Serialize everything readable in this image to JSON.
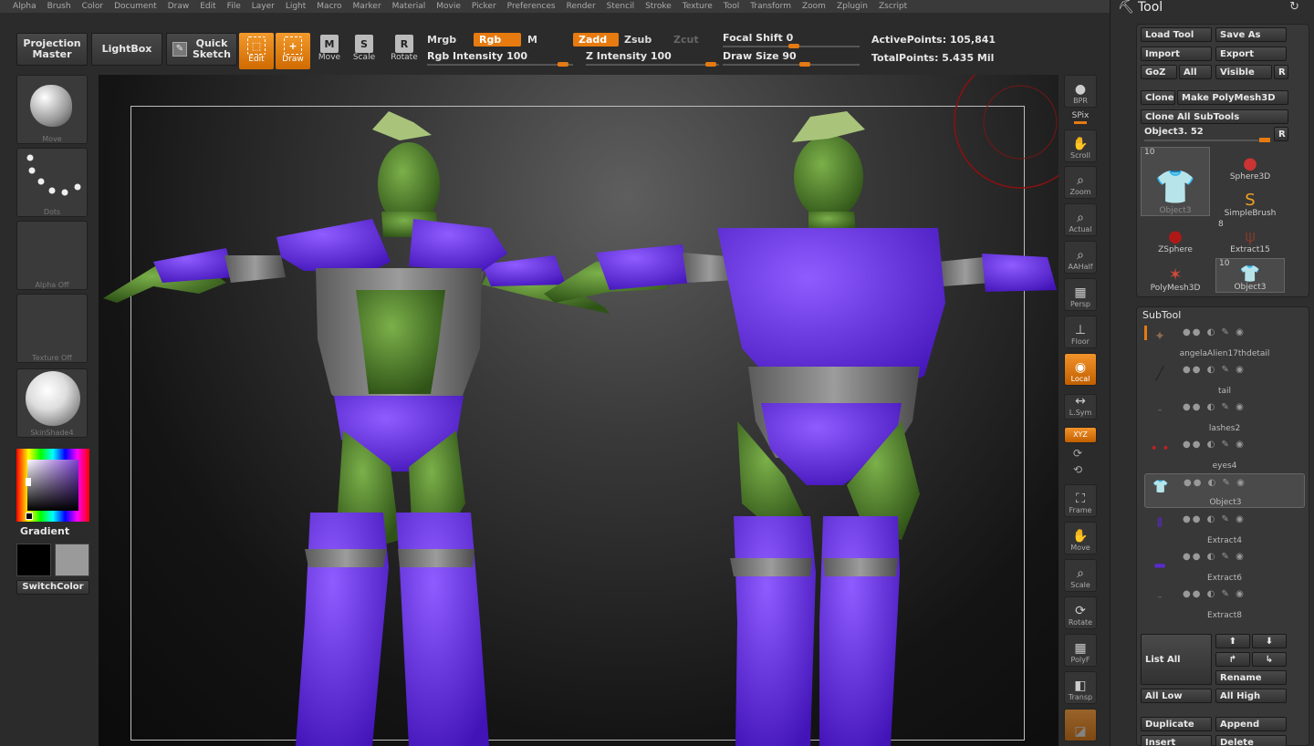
{
  "menu": [
    "Alpha",
    "Brush",
    "Color",
    "Document",
    "Draw",
    "Edit",
    "File",
    "Layer",
    "Light",
    "Macro",
    "Marker",
    "Material",
    "Movie",
    "Picker",
    "Preferences",
    "Render",
    "Stencil",
    "Stroke",
    "Texture",
    "Tool",
    "Transform",
    "Zoom",
    "Zplugin",
    "Zscript"
  ],
  "toolbar": {
    "projection_master": "Projection Master",
    "lightbox": "LightBox",
    "quick_sketch": "Quick Sketch",
    "edit": "Edit",
    "draw": "Draw",
    "move": "Move",
    "scale": "Scale",
    "rotate": "Rotate",
    "mrgb": "Mrgb",
    "rgb": "Rgb",
    "m": "M",
    "zadd": "Zadd",
    "zsub": "Zsub",
    "zcut": "Zcut",
    "rgb_intensity": "Rgb Intensity 100",
    "z_intensity": "Z Intensity 100",
    "focal_shift": "Focal Shift 0",
    "draw_size": "Draw Size 90",
    "active_points": "ActivePoints: 105,841",
    "total_points": "TotalPoints: 5.435 Mil",
    "sliders": {
      "rgb_intensity": 100,
      "z_intensity": 100,
      "focal_shift": 0,
      "draw_size": 90
    }
  },
  "left": {
    "brush": "Move",
    "stroke": "Dots",
    "alpha": "Alpha  Off",
    "texture": "Texture  Off",
    "material": "SkinShade4",
    "gradient": "Gradient",
    "switch_color": "SwitchColor"
  },
  "right_strip": [
    "BPR",
    "SPix",
    "Scroll",
    "Zoom",
    "Actual",
    "AAHalf",
    "Persp",
    "Floor",
    "Local",
    "L.Sym",
    "XYZ",
    "Frame",
    "Move",
    "Scale",
    "Rotate",
    "PolyF",
    "Transp"
  ],
  "tool_panel": {
    "title": "Tool",
    "load_tool": "Load Tool",
    "save_as": "Save As",
    "import": "Import",
    "export": "Export",
    "goz": "GoZ",
    "all": "All",
    "visible": "Visible",
    "r": "R",
    "clone": "Clone",
    "make_polymesh": "Make PolyMesh3D",
    "clone_all": "Clone  All  SubTools",
    "object_slider": "Object3. 52",
    "tools": [
      {
        "name": "Object3",
        "count": "10"
      },
      {
        "name": "Sphere3D",
        "count": ""
      },
      {
        "name": "SimpleBrush",
        "count": ""
      },
      {
        "name": "ZSphere",
        "count": ""
      },
      {
        "name": "Extract15",
        "count": "8"
      },
      {
        "name": "PolyMesh3D",
        "count": ""
      },
      {
        "name": "Object3",
        "count": "10"
      }
    ],
    "subtool_title": "SubTool",
    "subtools": [
      "angelaAlien17thdetail",
      "tail",
      "lashes2",
      "eyes4",
      "Object3",
      "Extract4",
      "Extract6",
      "Extract8"
    ],
    "list_all": "List  All",
    "rename": "Rename",
    "all_low": "All Low",
    "all_high": "All High",
    "duplicate": "Duplicate",
    "append": "Append",
    "insert": "Insert",
    "delete": "Delete"
  },
  "colors": {
    "accent": "#e77b10",
    "armor": "#6a2ef0",
    "skin": "#4c7a2a"
  }
}
